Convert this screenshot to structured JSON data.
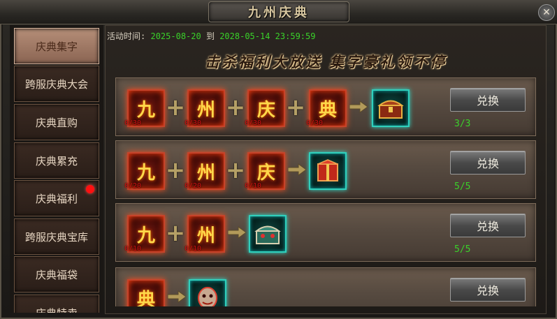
{
  "window": {
    "title": "九州庆典",
    "close_icon": "close-icon"
  },
  "sidebar": {
    "items": [
      {
        "label": "庆典集字",
        "active": true,
        "has_notice": false
      },
      {
        "label": "跨服庆典大会",
        "active": false,
        "has_notice": false
      },
      {
        "label": "庆典直购",
        "active": false,
        "has_notice": false
      },
      {
        "label": "庆典累充",
        "active": false,
        "has_notice": false
      },
      {
        "label": "庆典福利",
        "active": false,
        "has_notice": true
      },
      {
        "label": "跨服庆典宝库",
        "active": false,
        "has_notice": false
      },
      {
        "label": "庆典福袋",
        "active": false,
        "has_notice": false
      },
      {
        "label": "庆典特卖",
        "active": false,
        "has_notice": false
      }
    ]
  },
  "activity": {
    "time_label": "活动时间:",
    "start": "2025-08-20",
    "to": "到",
    "end": "2028-05-14 23:59:59"
  },
  "banner": "击杀福利大放送 集字豪礼领不停",
  "rows": [
    {
      "chars": [
        {
          "char": "九",
          "count": "0/30"
        },
        {
          "char": "州",
          "count": "0/30"
        },
        {
          "char": "庆",
          "count": "0/30"
        },
        {
          "char": "典",
          "count": "0/30"
        }
      ],
      "reward_icon": "treasure-chest-icon",
      "button": "兑换",
      "remaining": "3/3"
    },
    {
      "chars": [
        {
          "char": "九",
          "count": "0/20"
        },
        {
          "char": "州",
          "count": "0/20"
        },
        {
          "char": "庆",
          "count": "0/10"
        }
      ],
      "reward_icon": "red-gift-box-icon",
      "button": "兑换",
      "remaining": "5/5"
    },
    {
      "chars": [
        {
          "char": "九",
          "count": "0/10"
        },
        {
          "char": "州",
          "count": "0/10"
        }
      ],
      "reward_icon": "jewel-chest-icon",
      "button": "兑换",
      "remaining": "5/5"
    },
    {
      "chars": [
        {
          "char": "典",
          "count": ""
        }
      ],
      "reward_icon": "warrior-mask-icon",
      "button": "兑换",
      "remaining": ""
    }
  ],
  "colors": {
    "accent_green": "#3ad12a",
    "char_border": "#c6432a",
    "reward_border": "#2fd0bc",
    "notice_dot": "#ff1010"
  }
}
